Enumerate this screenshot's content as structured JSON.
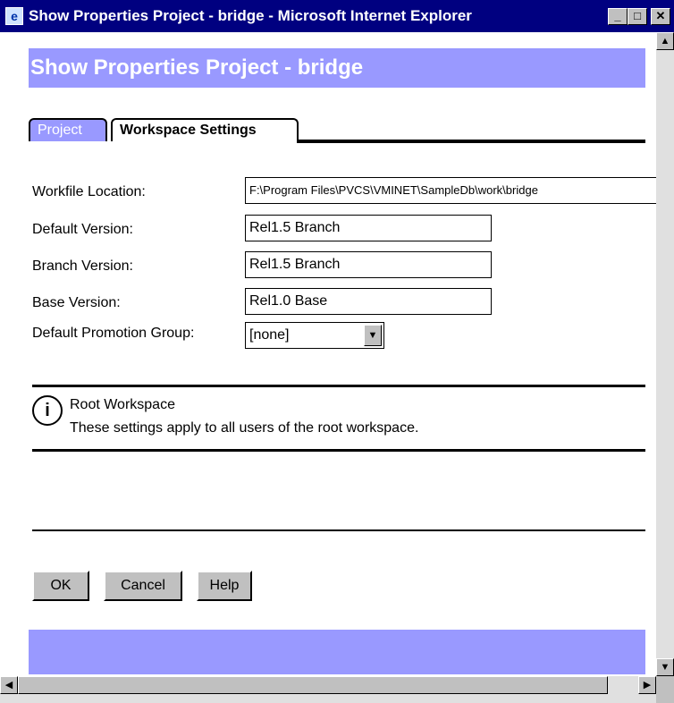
{
  "window": {
    "title": "Show Properties Project - bridge - Microsoft Internet Explorer",
    "icon": "ie-icon",
    "controls": [
      "minimize",
      "maximize",
      "close"
    ]
  },
  "header": {
    "title": "Show Properties Project - bridge"
  },
  "tabs": [
    {
      "label": "Project",
      "active": false
    },
    {
      "label": "Workspace Settings",
      "active": true
    }
  ],
  "form": {
    "workfile_location_label": "Workfile Location:",
    "workfile_location_value": "F:\\Program Files\\PVCS\\VMINET\\SampleDb\\work\\bridge",
    "default_version_label": "Default Version:",
    "default_version_value": "Rel1.5 Branch",
    "branch_version_label": "Branch Version:",
    "branch_version_value": "Rel1.5 Branch",
    "base_version_label": "Base Version:",
    "base_version_value": "Rel1.0 Base",
    "promotion_group_label": "Default Promotion Group:",
    "promotion_group_value": "[none]"
  },
  "info": {
    "title": "Root Workspace",
    "text": "These settings apply to all users of the root workspace."
  },
  "buttons": {
    "ok": "OK",
    "cancel": "Cancel",
    "help": "Help"
  },
  "colors": {
    "accent": "#9999ff",
    "titlebar": "#000080"
  }
}
